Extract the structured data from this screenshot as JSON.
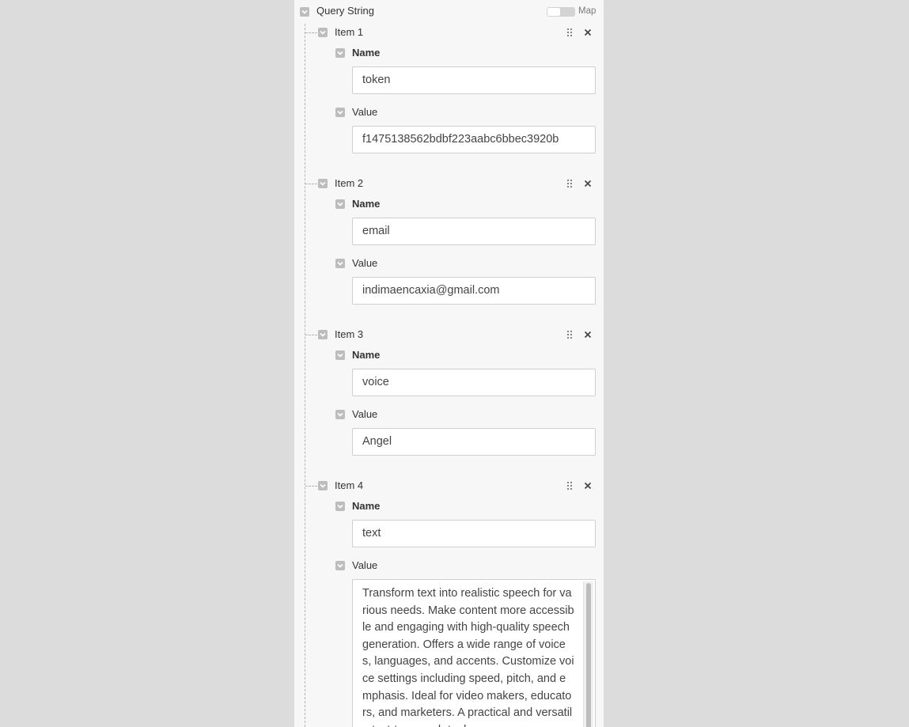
{
  "query_string": {
    "label": "Query String",
    "map_toggle_label": "Map",
    "items": [
      {
        "label": "Item 1",
        "name_label": "Name",
        "name_value": "token",
        "value_label": "Value",
        "value_value": "f1475138562bdbf223aabc6bbec3920b"
      },
      {
        "label": "Item 2",
        "name_label": "Name",
        "name_value": "email",
        "value_label": "Value",
        "value_value": "indimaencaxia@gmail.com"
      },
      {
        "label": "Item 3",
        "name_label": "Name",
        "name_value": "voice",
        "value_label": "Value",
        "value_value": "Angel"
      },
      {
        "label": "Item 4",
        "name_label": "Name",
        "name_value": "text",
        "value_label": "Value",
        "value_value": "Transform text into realistic speech for various needs. Make content more accessible and engaging with high-quality speech generation. Offers a wide range of voices, languages, and accents. Customize voice settings including speed, pitch, and emphasis. Ideal for video makers, educators, and marketers. A practical and versatile text-to-speech tool"
      }
    ]
  },
  "colors": {
    "background": "#dcdcdc",
    "panel": "#f7f7f7",
    "checkbox": "#bdbdbd"
  },
  "icons": {
    "collapse": "chevron-down-icon",
    "drag": "drag-handle-icon",
    "remove": "close-icon"
  }
}
